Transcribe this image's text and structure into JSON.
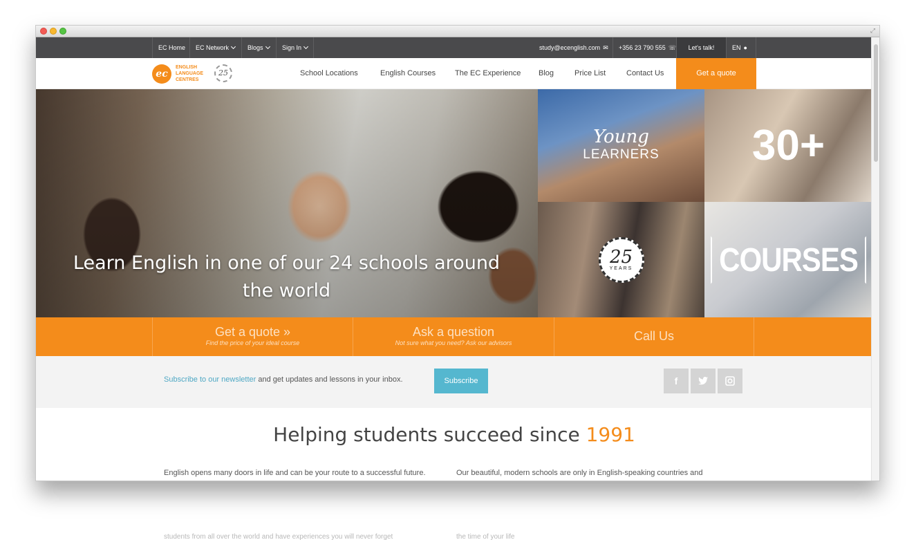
{
  "topbar": {
    "items": [
      {
        "label": "EC Home"
      },
      {
        "label": "EC Network"
      },
      {
        "label": "Blogs"
      },
      {
        "label": "Sign In"
      }
    ],
    "email": "study@ecenglish.com",
    "phone": "+356 23 790 555",
    "talk": "Let's talk!",
    "lang": "EN"
  },
  "logo": {
    "line1": "ENGLISH",
    "line2": "LANGUAGE",
    "line3": "CENTRES",
    "mark": "ec",
    "badge": "25"
  },
  "nav": {
    "items": [
      "School Locations",
      "English Courses",
      "The EC Experience",
      "Blog",
      "Price List",
      "Contact Us"
    ],
    "cta": "Get a quote"
  },
  "hero": {
    "caption": "Learn English in one of our 24 schools around the world",
    "tiles": {
      "young_line1": "Young",
      "young_line2": "LEARNERS",
      "thirty": "30+",
      "badge_num": "25",
      "badge_years": "YEARS",
      "courses": "COURSES"
    }
  },
  "actions": [
    {
      "title": "Get a quote »",
      "sub": "Find the price of your ideal course"
    },
    {
      "title": "Ask a question",
      "sub": "Not sure what you need? Ask our advisors"
    },
    {
      "title": "Call Us",
      "sub": ""
    }
  ],
  "newsletter": {
    "link": "Subscribe to our newsletter",
    "text": " and get updates and lessons in your inbox.",
    "button": "Subscribe",
    "social": [
      "f",
      "t",
      "ig"
    ]
  },
  "content": {
    "title": "Helping students succeed since ",
    "year": "1991",
    "col1": "English opens many doors in life and can be your route to a successful future.",
    "col2": "Our beautiful, modern schools are only in English-speaking countries and",
    "below1": "students from all over the world and have experiences you will never forget",
    "below2": "the time of your life"
  },
  "colors": {
    "accent": "#f48c1b",
    "topbar": "#4a4a4c",
    "subscribe": "#55b7cf"
  }
}
